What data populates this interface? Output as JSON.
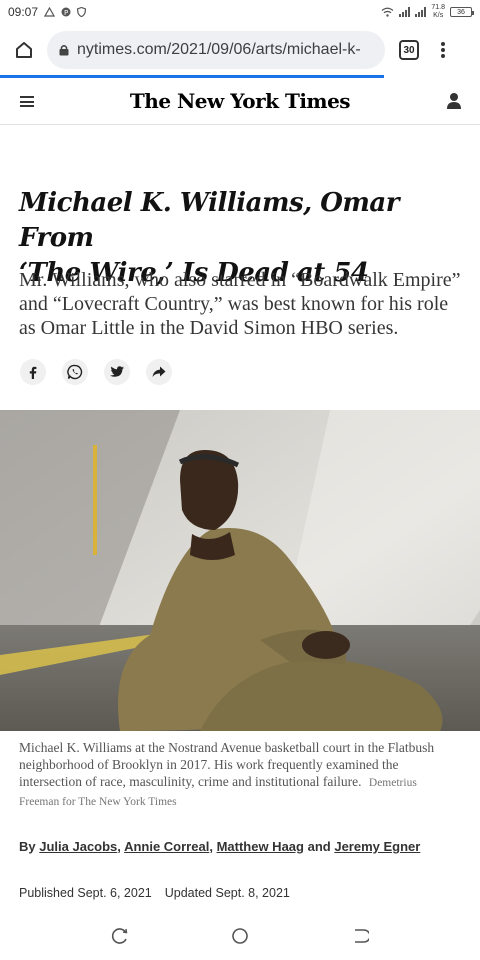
{
  "status_bar": {
    "time": "09:07",
    "net_speed_value": "71.8",
    "net_speed_unit": "K/s",
    "battery": "36"
  },
  "browser": {
    "url": "nytimes.com/2021/09/06/arts/michael-k-",
    "tab_count": "30",
    "load_progress": 0.8
  },
  "header": {
    "logo": "The New York Times"
  },
  "article": {
    "headline_line1": "Michael K. Williams, Omar From",
    "headline_line2": "‘The Wire,’ Is Dead at 54",
    "summary": "Mr. Williams, who also starred in “Boardwalk Empire” and “Lovecraft Country,” was best known for his role as Omar Little in the David Simon HBO series.",
    "caption": "Michael K. Williams at the Nostrand Avenue basketball court in the Flatbush neighborhood of Brooklyn in 2017. His work frequently examined the intersection of race, masculinity, crime and institutional failure.",
    "credit": "Demetrius Freeman for The New York Times",
    "byline_prefix": "By",
    "authors": [
      "Julia Jacobs",
      "Annie Correal",
      "Matthew Haag",
      "Jeremy Egner"
    ],
    "byline_sep1": ",",
    "byline_sep2": ",",
    "byline_sep3": "and",
    "published": "Published Sept. 6, 2021",
    "updated": "Updated Sept. 8, 2021"
  },
  "share_icons": [
    "facebook-icon",
    "whatsapp-icon",
    "twitter-icon",
    "share-icon"
  ],
  "colors": {
    "progress": "#1a73e8",
    "url_bg": "#eef0f3"
  }
}
